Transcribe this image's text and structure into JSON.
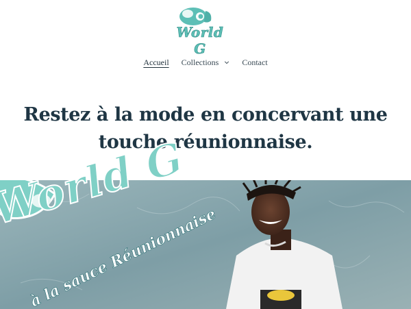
{
  "header": {
    "logo": {
      "text": "World G",
      "icon": "world-g-logo-icon",
      "color": "#5dbfb6"
    },
    "nav": {
      "items": [
        {
          "label": "Accueil",
          "active": true
        },
        {
          "label": "Collections",
          "has_dropdown": true
        },
        {
          "label": "Contact"
        }
      ]
    }
  },
  "hero": {
    "title": "Restez à la mode en concervant une touche réunionnaise."
  },
  "banner": {
    "overlay_text": "World G",
    "subtitle_text": "à la sauce Réunionnaise",
    "accent_color": "#7fd0c6",
    "background_color": "#8eaab1"
  }
}
